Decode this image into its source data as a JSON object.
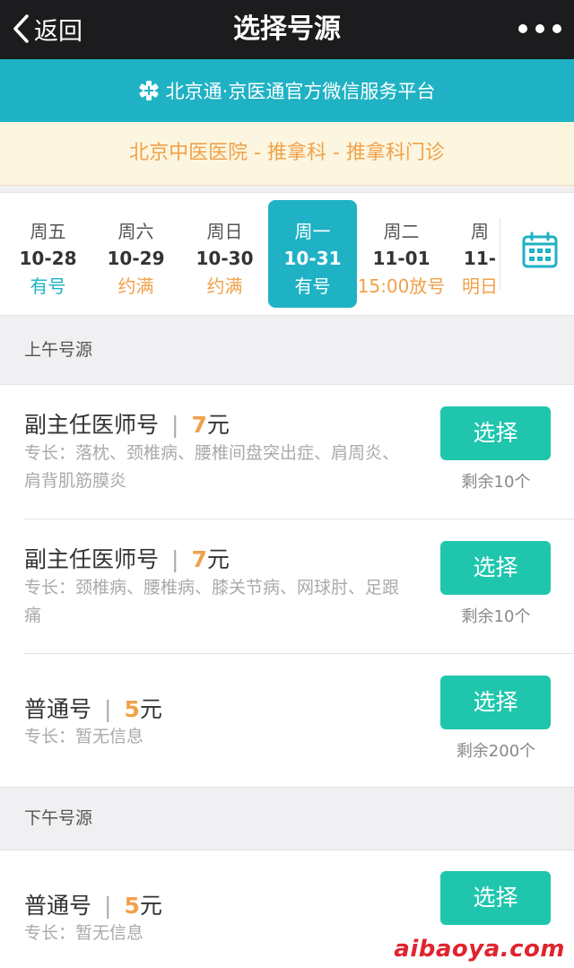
{
  "nav": {
    "back_label": "返回",
    "title": "选择号源"
  },
  "platform": {
    "text": "北京通·京医通官方微信服务平台"
  },
  "hospital": {
    "text": "北京中医医院 - 推拿科 - 推拿科门诊"
  },
  "dates": [
    {
      "weekday": "周五",
      "date": "10-28",
      "status": "有号",
      "status_type": "ok"
    },
    {
      "weekday": "周六",
      "date": "10-29",
      "status": "约满",
      "status_type": "full"
    },
    {
      "weekday": "周日",
      "date": "10-30",
      "status": "约满",
      "status_type": "full"
    },
    {
      "weekday": "周一",
      "date": "10-31",
      "status": "有号",
      "status_type": "ok",
      "selected": true
    },
    {
      "weekday": "周二",
      "date": "11-01",
      "status": "15:00放号",
      "status_type": "full"
    },
    {
      "weekday": "周",
      "date": "11-",
      "status": "明日",
      "status_type": "full"
    }
  ],
  "sections": {
    "morning": "上午号源",
    "afternoon": "下午号源"
  },
  "slots": [
    {
      "name": "副主任医师号",
      "price": "7",
      "unit": "元",
      "specialty": "专长：落枕、颈椎病、腰椎间盘突出症、肩周炎、肩背肌筋膜炎",
      "button": "选择",
      "remaining": "剩余10个"
    },
    {
      "name": "副主任医师号",
      "price": "7",
      "unit": "元",
      "specialty": "专长：颈椎病、腰椎病、膝关节病、网球肘、足跟痛",
      "button": "选择",
      "remaining": "剩余10个"
    },
    {
      "name": "普通号",
      "price": "5",
      "unit": "元",
      "specialty": "专长：暂无信息",
      "button": "选择",
      "remaining": "剩余200个"
    },
    {
      "name": "普通号",
      "price": "5",
      "unit": "元",
      "specialty": "专长：暂无信息",
      "button": "选择",
      "remaining": ""
    }
  ],
  "watermark": "aibaoya.com",
  "colors": {
    "accent": "#1fb2c4",
    "button": "#1fc6ad",
    "warn": "#f0a14a"
  }
}
